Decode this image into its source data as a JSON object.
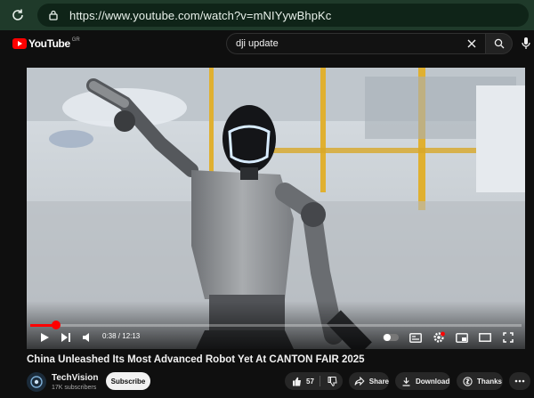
{
  "browser": {
    "url": "https://www.youtube.com/watch?v=mNIYywBhpKc"
  },
  "header": {
    "logo_text": "YouTube",
    "country_code": "GR",
    "search_value": "dji update"
  },
  "player": {
    "current_time": "0:38",
    "duration": "12:13",
    "time_display": "0:38 / 12:13",
    "progress_fraction": 0.052
  },
  "video": {
    "title": "China Unleashed Its Most Advanced Robot Yet At CANTON FAIR 2025"
  },
  "channel": {
    "name": "TechVision",
    "subscribers": "17K subscribers",
    "subscribe_label": "Subscribe"
  },
  "actions": {
    "like_count": "57",
    "share_label": "Share",
    "download_label": "Download",
    "thanks_label": "Thanks"
  },
  "colors": {
    "brand_red": "#ff0000",
    "browser_green": "#1f3a2a"
  }
}
